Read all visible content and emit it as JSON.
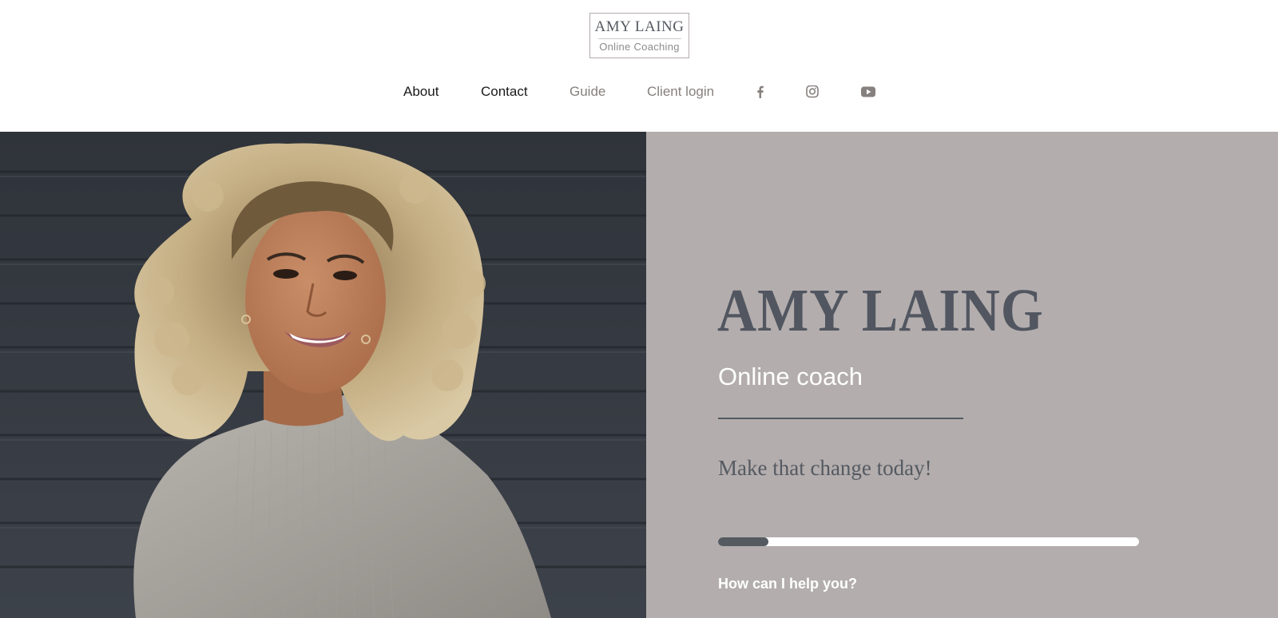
{
  "brand": {
    "logo_title": "AMY LAING",
    "logo_subtitle": "Online Coaching"
  },
  "nav": {
    "about": "About",
    "contact": "Contact",
    "guide": "Guide",
    "client_login": "Client login",
    "icons": [
      "facebook-icon",
      "instagram-icon",
      "youtube-icon"
    ]
  },
  "hero": {
    "name": "AMY LAING",
    "role": "Online coach",
    "tagline": "Make that change today!",
    "progress": 0.12,
    "help_text": "How can I help you?"
  },
  "colors": {
    "panel": "#b3adad",
    "accent": "#555a61",
    "nav_muted": "#86807e"
  }
}
